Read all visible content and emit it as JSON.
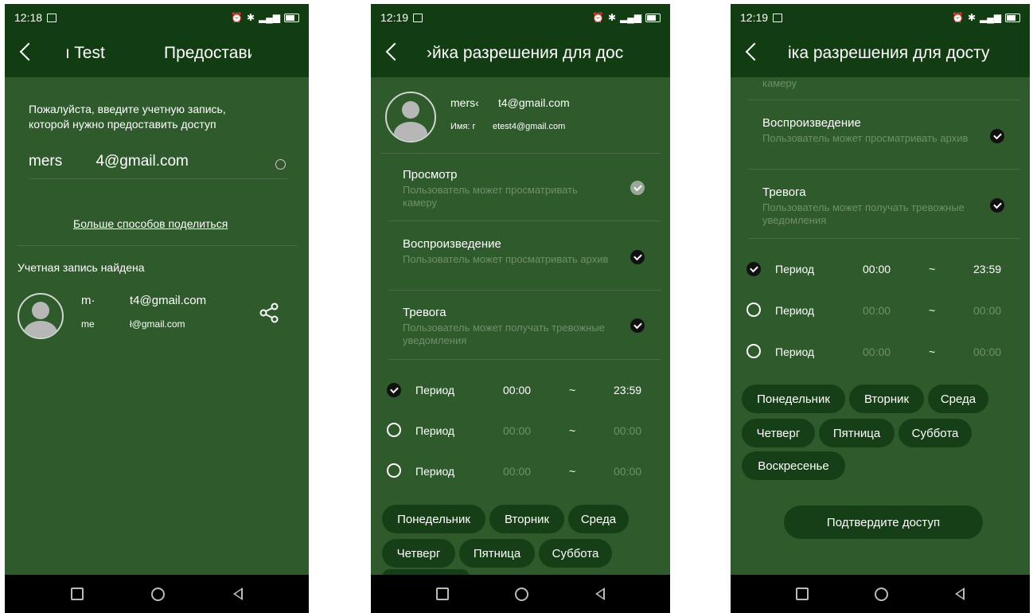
{
  "colors": {
    "header_bg": "#123d12",
    "content_bg": "#2e5a2c",
    "chip_bg": "#173f17",
    "muted_text": "#6f8f6b"
  },
  "screen1": {
    "status_time": "12:18",
    "title_left": "ı Test",
    "title_right": "Предостави",
    "instruction": "Пожалуйста, введите учетную запись, которой нужно предоставить доступ",
    "account_input_value": "mers        4@gmail.com",
    "more_ways_link": "Больше способов поделиться",
    "found_label": "Учетная запись найдена",
    "found_account": {
      "line1_prefix": "m·",
      "line1_email": "t4@gmail.com",
      "line2_prefix": "me",
      "line2_email": "ł@gmail.com"
    }
  },
  "screen2": {
    "status_time": "12:19",
    "title": "›йка разрешения для дос",
    "user": {
      "email_prefix": "mers‹",
      "email": "t4@gmail.com",
      "name_label": "Имя: г",
      "name_value": "etest4@gmail.com"
    },
    "permissions": [
      {
        "title": "Просмотр",
        "desc": "Пользователь может просматривать камеру",
        "checked": "light"
      },
      {
        "title": "Воспроизведение",
        "desc": "Пользователь может просматривать архив",
        "checked": "dark"
      },
      {
        "title": "Тревога",
        "desc": "Пользователь может получать тревожные уведомления",
        "checked": "dark"
      }
    ],
    "periods": [
      {
        "label": "Период",
        "start": "00:00",
        "sep": "~",
        "end": "23:59",
        "active": true
      },
      {
        "label": "Период",
        "start": "00:00",
        "sep": "~",
        "end": "00:00",
        "active": false
      },
      {
        "label": "Период",
        "start": "00:00",
        "sep": "~",
        "end": "00:00",
        "active": false
      }
    ],
    "days": [
      "Понедельник",
      "Вторник",
      "Среда",
      "Четверг",
      "Пятница",
      "Суббота"
    ]
  },
  "screen3": {
    "status_time": "12:19",
    "title": "іка разрешения для досту",
    "cut_text": "камеру",
    "permissions": [
      {
        "title": "Воспроизведение",
        "desc": "Пользователь может просматривать архив"
      },
      {
        "title": "Тревога",
        "desc": "Пользователь может получать тревожные уведомления"
      }
    ],
    "periods": [
      {
        "label": "Период",
        "start": "00:00",
        "sep": "~",
        "end": "23:59",
        "active": true
      },
      {
        "label": "Период",
        "start": "00:00",
        "sep": "~",
        "end": "00:00",
        "active": false
      },
      {
        "label": "Период",
        "start": "00:00",
        "sep": "~",
        "end": "00:00",
        "active": false
      }
    ],
    "days": [
      "Понедельник",
      "Вторник",
      "Среда",
      "Четверг",
      "Пятница",
      "Суббота",
      "Воскресенье"
    ],
    "confirm_label": "Подтвердите доступ"
  }
}
